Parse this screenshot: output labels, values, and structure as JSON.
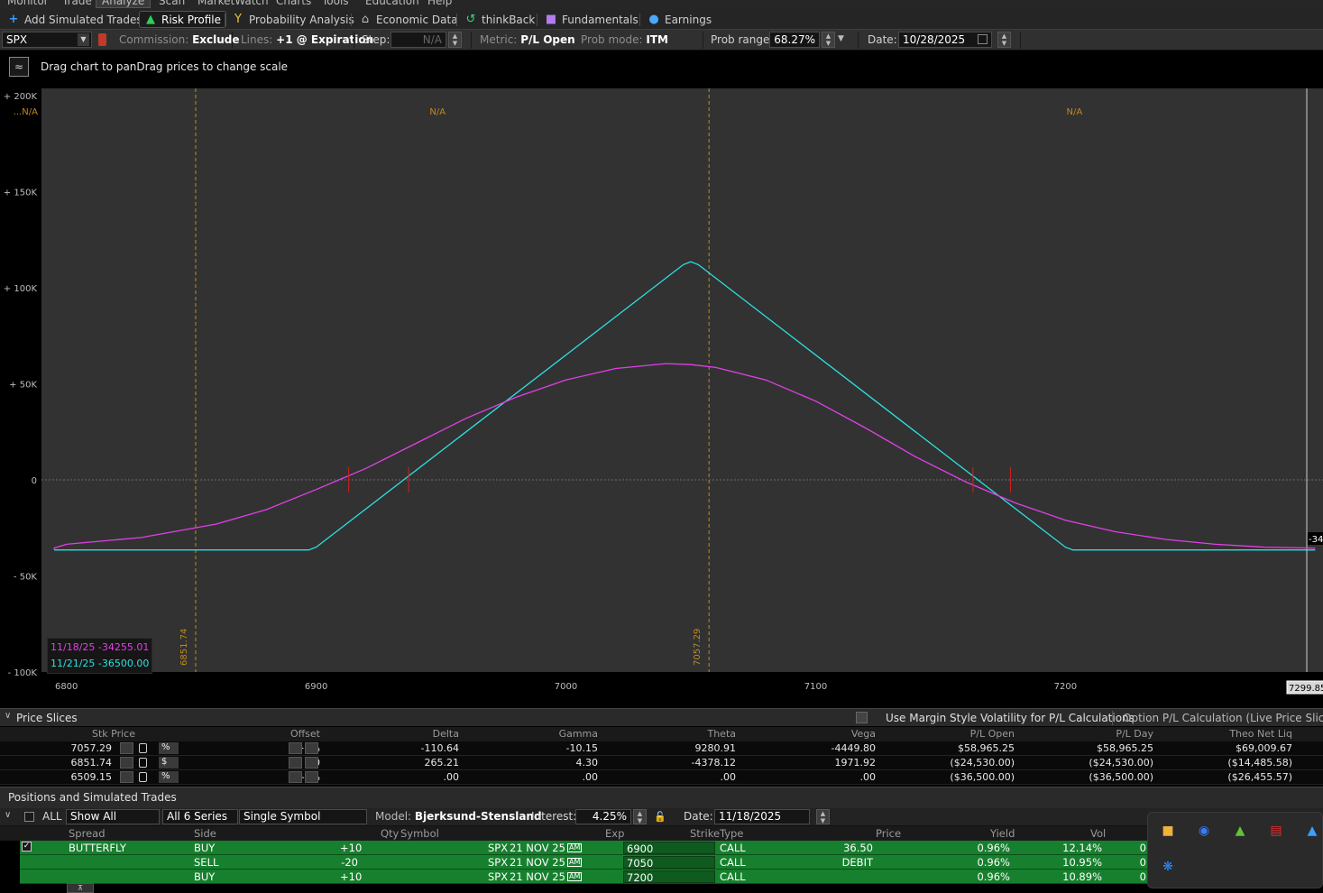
{
  "menu": {
    "items": [
      "Monitor",
      "Trade",
      "Analyze",
      "Scan",
      "MarketWatch",
      "Charts",
      "Tools",
      "Education",
      "Help"
    ],
    "active": "Analyze"
  },
  "toolbar": {
    "add_simulated_trades": "Add Simulated Trades",
    "risk_profile": "Risk Profile",
    "probability_analysis": "Probability Analysis",
    "economic_data": "Economic Data",
    "thinkback": "thinkBack",
    "fundamentals": "Fundamentals",
    "earnings": "Earnings"
  },
  "controls": {
    "symbol": "SPX",
    "commission_label": "Commission:",
    "commission_value": "Exclude",
    "lines_label": "Lines:",
    "lines_value": "+1 @ Expiration",
    "step_label": "Step:",
    "step_value": "N/A",
    "metric_label": "Metric:",
    "metric_value": "P/L Open",
    "prob_mode_label": "Prob mode:",
    "prob_mode_value": "ITM",
    "prob_range_label": "Prob range:",
    "prob_range_value": "68.27%",
    "date_label": "Date:",
    "date_value": "10/28/2025"
  },
  "chart_header": {
    "hint": "Drag chart to panDrag prices to change scale"
  },
  "chart_data": {
    "type": "line",
    "xlim": [
      6790,
      7297
    ],
    "ylim": [
      -100000,
      200000
    ],
    "x_ticks": [
      6800,
      6900,
      7000,
      7100,
      7200
    ],
    "y_ticks": [
      {
        "value": 200000,
        "label": "+ 200K"
      },
      {
        "value": 150000,
        "label": "+ 150K"
      },
      {
        "value": 100000,
        "label": "+ 100K"
      },
      {
        "value": 50000,
        "label": "+ 50K"
      },
      {
        "value": 0,
        "label": "0"
      },
      {
        "value": -50000,
        "label": "- 50K"
      },
      {
        "value": -100000,
        "label": "- 100K"
      }
    ],
    "price_lines": [
      {
        "value": 6851.74,
        "label": "6851.74"
      },
      {
        "value": 7057.29,
        "label": "7057.29"
      }
    ],
    "na_labels": [
      {
        "x": 6780,
        "text": "...N/A"
      },
      {
        "x": 6945,
        "text": "N/A"
      },
      {
        "x": 7200,
        "text": "N/A"
      }
    ],
    "cursor_price": "7299.85",
    "right_edge_label": "-34",
    "series": [
      {
        "name": "11/18/25",
        "legend": "11/18/25  -34255.01",
        "color": "#e040e8",
        "x": [
          6720,
          6760,
          6800,
          6830,
          6860,
          6880,
          6900,
          6920,
          6940,
          6960,
          6980,
          7000,
          7020,
          7040,
          7050,
          7060,
          7080,
          7100,
          7120,
          7140,
          7160,
          7180,
          7200,
          7220,
          7240,
          7260,
          7280,
          7300
        ],
        "values": [
          -36000,
          -35500,
          -33500,
          -30000,
          -23000,
          -15500,
          -5000,
          6000,
          19000,
          32000,
          43000,
          52000,
          58000,
          60500,
          60000,
          58500,
          52000,
          41000,
          27000,
          12000,
          -1000,
          -12000,
          -21000,
          -27000,
          -31000,
          -33500,
          -35000,
          -35500
        ]
      },
      {
        "name": "11/21/25",
        "legend": "11/21/25  -36500.00",
        "color": "#2ee0e0",
        "x": [
          6720,
          6897,
          6900,
          7047,
          7050,
          7053,
          7200,
          7203,
          7300
        ],
        "values": [
          -36500,
          -36500,
          -35000,
          112000,
          113500,
          112000,
          -35000,
          -36500,
          -36500
        ]
      }
    ],
    "breakeven_marks": [
      6913,
      6937,
      7163,
      7178
    ]
  },
  "price_slices": {
    "title": "Price Slices",
    "use_margin_label": "Use Margin Style Volatility for P/L Calculations",
    "option_pl_label": "Option P/L Calculation (Live Price Slice) : Th",
    "headers": [
      "Stk Price",
      "Offset",
      "Delta",
      "Gamma",
      "Theta",
      "Vega",
      "P/L Open",
      "P/L Day",
      "Theo Net Liq"
    ],
    "rows": [
      {
        "stk": "7057.29",
        "unit": "%",
        "offset": "+3%",
        "delta": "-110.64",
        "gamma": "-10.15",
        "theta": "9280.91",
        "vega": "-4449.80",
        "pl_open": "$58,965.25",
        "pl_day": "$58,965.25",
        "theo": "$69,009.67"
      },
      {
        "stk": "6851.74",
        "unit": "$",
        "offset": "$0",
        "delta": "265.21",
        "gamma": "4.30",
        "theta": "-4378.12",
        "vega": "1971.92",
        "pl_open": "($24,530.00)",
        "pl_day": "($24,530.00)",
        "theo": "($14,485.58)"
      },
      {
        "stk": "6509.15",
        "unit": "%",
        "offset": "-5%",
        "delta": ".00",
        "gamma": ".00",
        "theta": ".00",
        "vega": ".00",
        "pl_open": "($36,500.00)",
        "pl_day": "($36,500.00)",
        "theo": "($26,455.57)"
      }
    ]
  },
  "positions": {
    "title": "Positions and Simulated Trades",
    "all_label": "ALL",
    "filter": "Show All",
    "series": "All 6 Series",
    "symbol_mode": "Single Symbol",
    "model_label": "Model:",
    "model_value": "Bjerksund-Stensland",
    "interest_label": "Interest:",
    "interest_value": "4.25%",
    "date_label": "Date:",
    "date_value": "11/18/2025",
    "headers": [
      "Spread",
      "Side",
      "Qty",
      "Symbol",
      "Exp",
      "Strike",
      "Type",
      "Price",
      "Yield",
      "Vol"
    ],
    "rows": [
      {
        "spread": "BUTTERFLY",
        "side": "BUY",
        "qty": "+10",
        "symbol": "SPX",
        "exp": "21 NOV 25",
        "am": "AM",
        "strike": "6900",
        "type": "CALL",
        "price": "36.50",
        "yield": "0.96%",
        "vol": "12.14%",
        "tail": "0"
      },
      {
        "spread": "",
        "side": "SELL",
        "qty": "-20",
        "symbol": "SPX",
        "exp": "21 NOV 25",
        "am": "AM",
        "strike": "7050",
        "type": "CALL",
        "price": "DEBIT",
        "yield": "0.96%",
        "vol": "10.95%",
        "tail": "0"
      },
      {
        "spread": "",
        "side": "BUY",
        "qty": "+10",
        "symbol": "SPX",
        "exp": "21 NOV 25",
        "am": "AM",
        "strike": "7200",
        "type": "CALL",
        "price": "",
        "yield": "0.96%",
        "vol": "10.89%",
        "tail": "0"
      }
    ]
  }
}
